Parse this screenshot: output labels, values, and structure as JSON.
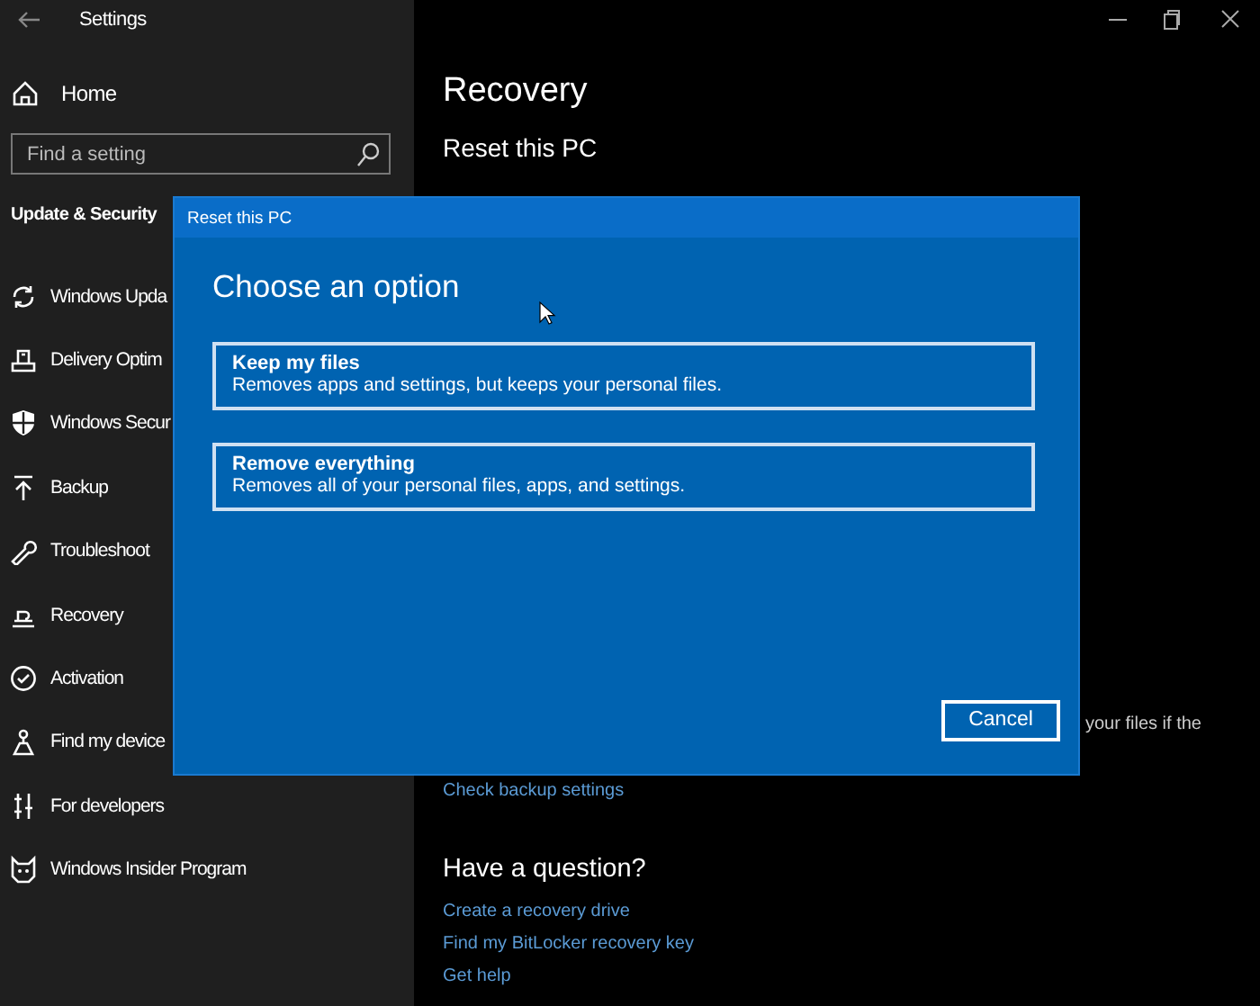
{
  "window": {
    "title": "Settings"
  },
  "sidebar": {
    "home": "Home",
    "search": {
      "placeholder": "Find a setting"
    },
    "section": "Update & Security",
    "items": [
      {
        "label": "Windows Upda"
      },
      {
        "label": "Delivery Optim"
      },
      {
        "label": "Windows Secur"
      },
      {
        "label": "Backup"
      },
      {
        "label": "Troubleshoot"
      },
      {
        "label": "Recovery"
      },
      {
        "label": "Activation"
      },
      {
        "label": "Find my device"
      },
      {
        "label": "For developers"
      },
      {
        "label": "Windows Insider Program"
      }
    ]
  },
  "main": {
    "title": "Recovery",
    "subtitle": "Reset this PC",
    "hidden_text": "your files if the",
    "backup_link": "Check backup settings",
    "question_heading": "Have a question?",
    "links": [
      "Create a recovery drive",
      "Find my BitLocker recovery key",
      "Get help"
    ]
  },
  "dialog": {
    "title": "Reset this PC",
    "heading": "Choose an option",
    "options": [
      {
        "title": "Keep my files",
        "description": "Removes apps and settings, but keeps your personal files."
      },
      {
        "title": "Remove everything",
        "description": "Removes all of your personal files, apps, and settings."
      }
    ],
    "cancel": "Cancel"
  }
}
